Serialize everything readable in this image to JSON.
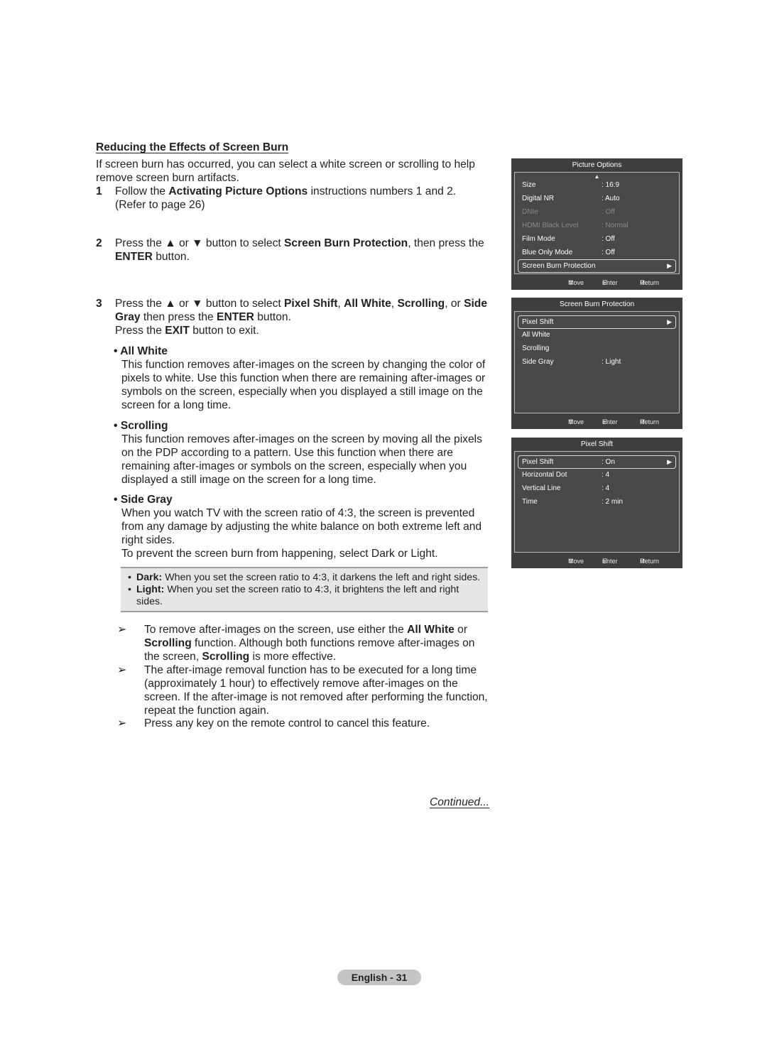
{
  "document": {
    "heading": "Reducing the Effects of Screen Burn",
    "intro": "If screen burn has occurred, you can select a white screen or scrolling to help remove screen burn artifacts.",
    "steps": [
      {
        "number": "1",
        "parts": [
          "Follow the ",
          "Activating Picture Options",
          " instructions numbers 1 and 2.",
          "(Refer to page 26)"
        ]
      },
      {
        "number": "2",
        "parts": [
          "Press the ▲ or ▼ button to select ",
          "Screen Burn Protection",
          ", then press the ",
          "ENTER",
          " button."
        ]
      },
      {
        "number": "3",
        "parts": [
          "Press the ▲ or ▼ button to select ",
          "Pixel Shift",
          ", ",
          "All White",
          ", ",
          "Scrolling",
          ", or ",
          "Side Gray",
          " then press the ",
          "ENTER",
          " button.",
          "Press the ",
          "EXIT",
          " button to exit."
        ]
      }
    ],
    "bullets": [
      {
        "title": "All White",
        "desc": "This function removes after-images on the screen by changing the color of pixels to white. Use this function when there are remaining after-images or symbols on the screen, especially when you displayed a still image on the screen for a long time."
      },
      {
        "title": "Scrolling",
        "desc": "This function removes after-images on the screen by moving all the pixels on the PDP according to a pattern. Use this function when there are remaining after-images or symbols on the screen, especially when you displayed a still image on the screen for a long time."
      },
      {
        "title": "Side Gray",
        "desc": "When you watch TV with the screen ratio of 4:3, the screen is prevented from any damage by adjusting the white balance on both extreme left and right sides.",
        "desc2": "To prevent the screen burn from happening, select Dark or Light."
      }
    ],
    "notes": [
      {
        "term": "Dark:",
        "text": " When you set the screen ratio to 4:3, it darkens the left and right sides."
      },
      {
        "term": "Light:",
        "text": " When you set the screen ratio to 4:3, it brightens the left and right sides."
      }
    ],
    "tips": [
      {
        "parts": [
          "To remove after-images on the screen, use either the ",
          "All White",
          " or ",
          "Scrolling",
          " function. Although both functions remove after-images on the screen, ",
          "Scrolling",
          " is more effective."
        ]
      },
      {
        "parts": [
          "The after-image removal function has to be executed for a long time (approximately 1 hour) to effectively remove after-images on the screen. If the after-image is not removed after performing the function, repeat the function again."
        ]
      },
      {
        "parts": [
          "Press any key on the remote control to cancel this feature."
        ]
      }
    ],
    "tip_arrow": "➢",
    "bullet_glyph": "•",
    "continued": "Continued...",
    "page_label": "English - 31"
  },
  "osd_panels": [
    {
      "title": "Picture Options",
      "has_up_arrow": true,
      "up_arrow": "▲",
      "rows": [
        {
          "label": "Size",
          "value": ": 16:9",
          "state": "normal"
        },
        {
          "label": "Digital NR",
          "value": ": Auto",
          "state": "normal"
        },
        {
          "label": "DNIe",
          "value": ": Off",
          "state": "disabled"
        },
        {
          "label": "HDMI Black Level",
          "value": ": Normal",
          "state": "disabled"
        },
        {
          "label": "Film Mode",
          "value": ": Off",
          "state": "normal"
        },
        {
          "label": "Blue Only Mode",
          "value": ": Off",
          "state": "normal"
        },
        {
          "label": "Screen Burn Protection",
          "value": "",
          "state": "selected",
          "submenu": "▶"
        }
      ]
    },
    {
      "title": "Screen Burn Protection",
      "has_up_arrow": false,
      "rows": [
        {
          "label": "Pixel Shift",
          "value": "",
          "state": "selected",
          "submenu": "▶"
        },
        {
          "label": "All White",
          "value": "",
          "state": "normal"
        },
        {
          "label": "Scrolling",
          "value": "",
          "state": "normal"
        },
        {
          "label": "Side Gray",
          "value": ": Light",
          "state": "normal"
        }
      ]
    },
    {
      "title": "Pixel Shift",
      "has_up_arrow": false,
      "rows": [
        {
          "label": "Pixel Shift",
          "value": ": On",
          "state": "selected",
          "submenu": "▶"
        },
        {
          "label": "Horizontal Dot",
          "value": ": 4",
          "state": "normal"
        },
        {
          "label": "Vertical Line",
          "value": ": 4",
          "state": "normal"
        },
        {
          "label": "Time",
          "value": ": 2 min",
          "state": "normal"
        }
      ]
    }
  ],
  "osd_footer": {
    "move_icon": "⇕",
    "move_label": "Move",
    "enter_icon": "⏎",
    "enter_label": "Enter",
    "return_icon": "↺",
    "return_label": "Return"
  },
  "colors": {
    "osd_background": "#3e3e3e",
    "osd_inner": "#484848",
    "osd_disabled_text": "#8a8a8a",
    "note_background": "#e6e6e6",
    "page_badge": "#c4c4c4"
  }
}
